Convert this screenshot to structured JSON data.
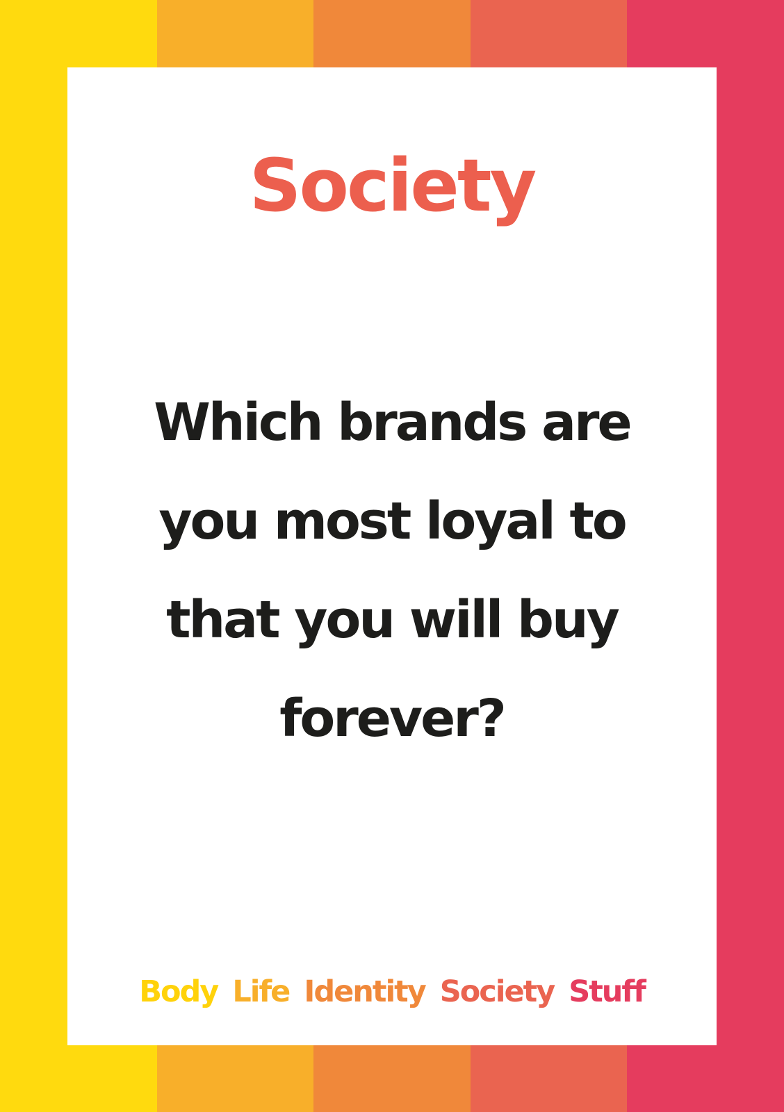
{
  "background": {
    "stripe_colors": [
      "#FFDA0E",
      "#F8AF2A",
      "#F0883A",
      "#EA6450",
      "#E53C5E"
    ]
  },
  "card": {
    "category_title": "Society",
    "category_color": "#EC5F4E",
    "question": "Which brands are you most loyal to that you will buy forever?"
  },
  "footer": {
    "items": [
      {
        "label": "Body",
        "color": "#FFD20A"
      },
      {
        "label": "Life",
        "color": "#F8AF2A"
      },
      {
        "label": "Identity",
        "color": "#F0883A"
      },
      {
        "label": "Society",
        "color": "#EA6450"
      },
      {
        "label": "Stuff",
        "color": "#E53C5E"
      }
    ]
  }
}
